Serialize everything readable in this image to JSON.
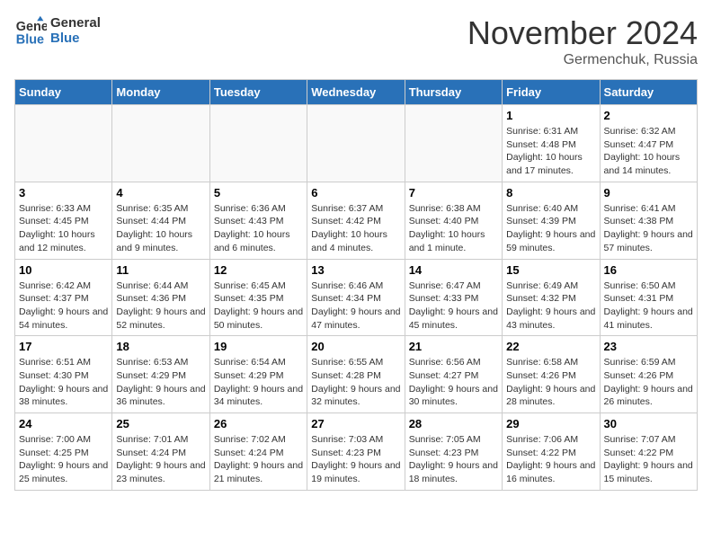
{
  "header": {
    "logo_line1": "General",
    "logo_line2": "Blue",
    "month": "November 2024",
    "location": "Germenchuk, Russia"
  },
  "weekdays": [
    "Sunday",
    "Monday",
    "Tuesday",
    "Wednesday",
    "Thursday",
    "Friday",
    "Saturday"
  ],
  "weeks": [
    [
      {
        "day": "",
        "sunrise": "",
        "sunset": "",
        "daylight": ""
      },
      {
        "day": "",
        "sunrise": "",
        "sunset": "",
        "daylight": ""
      },
      {
        "day": "",
        "sunrise": "",
        "sunset": "",
        "daylight": ""
      },
      {
        "day": "",
        "sunrise": "",
        "sunset": "",
        "daylight": ""
      },
      {
        "day": "",
        "sunrise": "",
        "sunset": "",
        "daylight": ""
      },
      {
        "day": "1",
        "sunrise": "Sunrise: 6:31 AM",
        "sunset": "Sunset: 4:48 PM",
        "daylight": "Daylight: 10 hours and 17 minutes."
      },
      {
        "day": "2",
        "sunrise": "Sunrise: 6:32 AM",
        "sunset": "Sunset: 4:47 PM",
        "daylight": "Daylight: 10 hours and 14 minutes."
      }
    ],
    [
      {
        "day": "3",
        "sunrise": "Sunrise: 6:33 AM",
        "sunset": "Sunset: 4:45 PM",
        "daylight": "Daylight: 10 hours and 12 minutes."
      },
      {
        "day": "4",
        "sunrise": "Sunrise: 6:35 AM",
        "sunset": "Sunset: 4:44 PM",
        "daylight": "Daylight: 10 hours and 9 minutes."
      },
      {
        "day": "5",
        "sunrise": "Sunrise: 6:36 AM",
        "sunset": "Sunset: 4:43 PM",
        "daylight": "Daylight: 10 hours and 6 minutes."
      },
      {
        "day": "6",
        "sunrise": "Sunrise: 6:37 AM",
        "sunset": "Sunset: 4:42 PM",
        "daylight": "Daylight: 10 hours and 4 minutes."
      },
      {
        "day": "7",
        "sunrise": "Sunrise: 6:38 AM",
        "sunset": "Sunset: 4:40 PM",
        "daylight": "Daylight: 10 hours and 1 minute."
      },
      {
        "day": "8",
        "sunrise": "Sunrise: 6:40 AM",
        "sunset": "Sunset: 4:39 PM",
        "daylight": "Daylight: 9 hours and 59 minutes."
      },
      {
        "day": "9",
        "sunrise": "Sunrise: 6:41 AM",
        "sunset": "Sunset: 4:38 PM",
        "daylight": "Daylight: 9 hours and 57 minutes."
      }
    ],
    [
      {
        "day": "10",
        "sunrise": "Sunrise: 6:42 AM",
        "sunset": "Sunset: 4:37 PM",
        "daylight": "Daylight: 9 hours and 54 minutes."
      },
      {
        "day": "11",
        "sunrise": "Sunrise: 6:44 AM",
        "sunset": "Sunset: 4:36 PM",
        "daylight": "Daylight: 9 hours and 52 minutes."
      },
      {
        "day": "12",
        "sunrise": "Sunrise: 6:45 AM",
        "sunset": "Sunset: 4:35 PM",
        "daylight": "Daylight: 9 hours and 50 minutes."
      },
      {
        "day": "13",
        "sunrise": "Sunrise: 6:46 AM",
        "sunset": "Sunset: 4:34 PM",
        "daylight": "Daylight: 9 hours and 47 minutes."
      },
      {
        "day": "14",
        "sunrise": "Sunrise: 6:47 AM",
        "sunset": "Sunset: 4:33 PM",
        "daylight": "Daylight: 9 hours and 45 minutes."
      },
      {
        "day": "15",
        "sunrise": "Sunrise: 6:49 AM",
        "sunset": "Sunset: 4:32 PM",
        "daylight": "Daylight: 9 hours and 43 minutes."
      },
      {
        "day": "16",
        "sunrise": "Sunrise: 6:50 AM",
        "sunset": "Sunset: 4:31 PM",
        "daylight": "Daylight: 9 hours and 41 minutes."
      }
    ],
    [
      {
        "day": "17",
        "sunrise": "Sunrise: 6:51 AM",
        "sunset": "Sunset: 4:30 PM",
        "daylight": "Daylight: 9 hours and 38 minutes."
      },
      {
        "day": "18",
        "sunrise": "Sunrise: 6:53 AM",
        "sunset": "Sunset: 4:29 PM",
        "daylight": "Daylight: 9 hours and 36 minutes."
      },
      {
        "day": "19",
        "sunrise": "Sunrise: 6:54 AM",
        "sunset": "Sunset: 4:29 PM",
        "daylight": "Daylight: 9 hours and 34 minutes."
      },
      {
        "day": "20",
        "sunrise": "Sunrise: 6:55 AM",
        "sunset": "Sunset: 4:28 PM",
        "daylight": "Daylight: 9 hours and 32 minutes."
      },
      {
        "day": "21",
        "sunrise": "Sunrise: 6:56 AM",
        "sunset": "Sunset: 4:27 PM",
        "daylight": "Daylight: 9 hours and 30 minutes."
      },
      {
        "day": "22",
        "sunrise": "Sunrise: 6:58 AM",
        "sunset": "Sunset: 4:26 PM",
        "daylight": "Daylight: 9 hours and 28 minutes."
      },
      {
        "day": "23",
        "sunrise": "Sunrise: 6:59 AM",
        "sunset": "Sunset: 4:26 PM",
        "daylight": "Daylight: 9 hours and 26 minutes."
      }
    ],
    [
      {
        "day": "24",
        "sunrise": "Sunrise: 7:00 AM",
        "sunset": "Sunset: 4:25 PM",
        "daylight": "Daylight: 9 hours and 25 minutes."
      },
      {
        "day": "25",
        "sunrise": "Sunrise: 7:01 AM",
        "sunset": "Sunset: 4:24 PM",
        "daylight": "Daylight: 9 hours and 23 minutes."
      },
      {
        "day": "26",
        "sunrise": "Sunrise: 7:02 AM",
        "sunset": "Sunset: 4:24 PM",
        "daylight": "Daylight: 9 hours and 21 minutes."
      },
      {
        "day": "27",
        "sunrise": "Sunrise: 7:03 AM",
        "sunset": "Sunset: 4:23 PM",
        "daylight": "Daylight: 9 hours and 19 minutes."
      },
      {
        "day": "28",
        "sunrise": "Sunrise: 7:05 AM",
        "sunset": "Sunset: 4:23 PM",
        "daylight": "Daylight: 9 hours and 18 minutes."
      },
      {
        "day": "29",
        "sunrise": "Sunrise: 7:06 AM",
        "sunset": "Sunset: 4:22 PM",
        "daylight": "Daylight: 9 hours and 16 minutes."
      },
      {
        "day": "30",
        "sunrise": "Sunrise: 7:07 AM",
        "sunset": "Sunset: 4:22 PM",
        "daylight": "Daylight: 9 hours and 15 minutes."
      }
    ]
  ]
}
